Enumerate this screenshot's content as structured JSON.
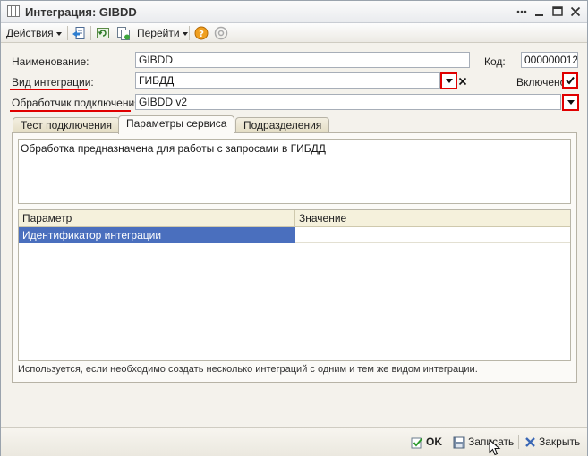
{
  "window": {
    "title": "Интеграция: GIBDD"
  },
  "toolbar": {
    "actions_label": "Действия",
    "goto_label": "Перейти"
  },
  "form": {
    "name_label": "Наименование:",
    "name_value": "GIBDD",
    "code_label": "Код:",
    "code_value": "000000012",
    "type_label": "Вид интеграции:",
    "type_value": "ГИБДД",
    "enabled_label": "Включено",
    "enabled_checked": true,
    "handler_label": "Обработчик подключения:",
    "handler_value": "GIBDD v2"
  },
  "tabs": [
    {
      "label": "Тест подключения",
      "active": false
    },
    {
      "label": "Параметры сервиса",
      "active": true
    },
    {
      "label": "Подразделения",
      "active": false
    }
  ],
  "service_params": {
    "description": "Обработка предназначена для работы с запросами в ГИБДД",
    "columns": [
      "Параметр",
      "Значение"
    ],
    "rows": [
      {
        "param": "Идентификатор интеграции",
        "value": ""
      }
    ],
    "hint": "Используется, если необходимо создать несколько интеграций с одним и тем же видом интеграции."
  },
  "buttons": {
    "ok": "OK",
    "save": "Записать",
    "close": "Закрыть"
  },
  "colors": {
    "highlight_red": "#e00000",
    "selected_row": "#4a6fbe"
  }
}
